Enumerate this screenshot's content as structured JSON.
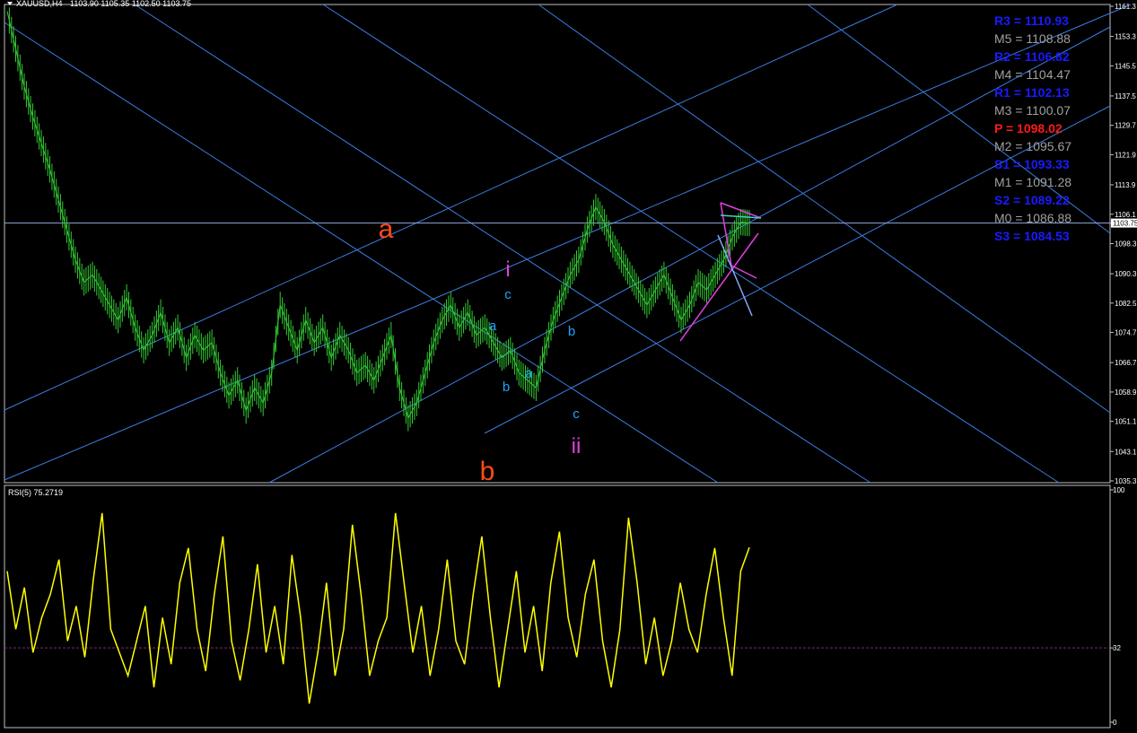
{
  "header": {
    "symbol_info": "XAUUSD,H4",
    "ohlc": "1103.90 1105.35 1102.50 1103.75"
  },
  "rsi": {
    "label": "RSI(5) 75.2719",
    "levels": [
      "100",
      "32",
      "0"
    ]
  },
  "colors": {
    "background": "#000000",
    "frame": "#c0c0c0",
    "candles": "#33cc33",
    "channel_lines": "#3a7de0",
    "rsi_line": "#ffff00",
    "rsi_level": "#7a2a7a",
    "wave_major": "#ff4a1a",
    "wave_minor": "#1ea4ff",
    "wave_mid": "#e040e0",
    "pivot_r": "#1a1aff",
    "pivot_m": "#a0a0a0",
    "pivot_p": "#ff1a1a"
  },
  "wave_labels": [
    "a",
    "b",
    "i",
    "ii",
    "c",
    "a",
    "b",
    "a",
    "b",
    "c"
  ],
  "pivots": [
    {
      "label": "R3 = 1110.93",
      "type": "R"
    },
    {
      "label": "M5 = 1108.88",
      "type": "M"
    },
    {
      "label": "R2 = 1106.82",
      "type": "R"
    },
    {
      "label": "M4 = 1104.47",
      "type": "M"
    },
    {
      "label": "R1 = 1102.13",
      "type": "R"
    },
    {
      "label": "M3 = 1100.07",
      "type": "M"
    },
    {
      "label": "P  = 1098.02",
      "type": "P"
    },
    {
      "label": "M2 = 1095.67",
      "type": "M"
    },
    {
      "label": "S1 = 1093.33",
      "type": "R"
    },
    {
      "label": "M1 = 1091.28",
      "type": "M"
    },
    {
      "label": "S2 = 1089.22",
      "type": "R"
    },
    {
      "label": "M0 = 1086.88",
      "type": "M"
    },
    {
      "label": "S3 = 1084.53",
      "type": "R"
    }
  ],
  "chart_data": [
    {
      "type": "line",
      "title": "XAUUSD,H4",
      "y_ticks": [
        "1161.3",
        "1153.3",
        "1145.5",
        "1137.5",
        "1129.7",
        "1121.9",
        "1113.9",
        "1106.1",
        "1103.7",
        "1098.3",
        "1090.3",
        "1082.5",
        "1074.7",
        "1066.7",
        "1058.9",
        "1051.1",
        "1043.1",
        "1035.3"
      ],
      "ylim": [
        1035.3,
        1161.3
      ],
      "current_price": 1103.75,
      "series": [
        {
          "values": [
            1160,
            1150,
            1140,
            1132,
            1125,
            1118,
            1110,
            1102,
            1094,
            1088,
            1090,
            1086,
            1082,
            1078,
            1084,
            1076,
            1070,
            1074,
            1080,
            1072,
            1076,
            1068,
            1074,
            1070,
            1072,
            1064,
            1058,
            1062,
            1054,
            1060,
            1056,
            1064,
            1082,
            1076,
            1070,
            1078,
            1072,
            1076,
            1068,
            1074,
            1070,
            1064,
            1066,
            1062,
            1068,
            1074,
            1060,
            1052,
            1056,
            1064,
            1072,
            1078,
            1082,
            1076,
            1080,
            1074,
            1076,
            1072,
            1068,
            1070,
            1064,
            1062,
            1060,
            1070,
            1078,
            1084,
            1090,
            1094,
            1102,
            1108,
            1104,
            1098,
            1094,
            1090,
            1086,
            1082,
            1086,
            1090,
            1084,
            1078,
            1082,
            1088,
            1086,
            1090,
            1094,
            1100,
            1104,
            1103.75
          ]
        }
      ]
    },
    {
      "type": "line",
      "title": "RSI(5) 75.2719",
      "ylim": [
        0,
        100
      ],
      "level": 32,
      "series": [
        {
          "values": [
            65,
            40,
            58,
            30,
            45,
            55,
            70,
            35,
            50,
            28,
            62,
            90,
            40,
            30,
            20,
            35,
            50,
            15,
            45,
            25,
            60,
            75,
            40,
            22,
            55,
            80,
            35,
            18,
            40,
            68,
            30,
            50,
            25,
            72,
            45,
            8,
            30,
            60,
            20,
            40,
            85,
            55,
            20,
            35,
            45,
            90,
            60,
            30,
            50,
            20,
            40,
            70,
            35,
            25,
            55,
            80,
            45,
            15,
            40,
            65,
            30,
            50,
            22,
            60,
            82,
            45,
            28,
            55,
            70,
            35,
            15,
            40,
            88,
            60,
            25,
            45,
            20,
            35,
            60,
            40,
            30,
            55,
            75,
            45,
            20,
            65,
            75.27
          ]
        }
      ]
    }
  ]
}
